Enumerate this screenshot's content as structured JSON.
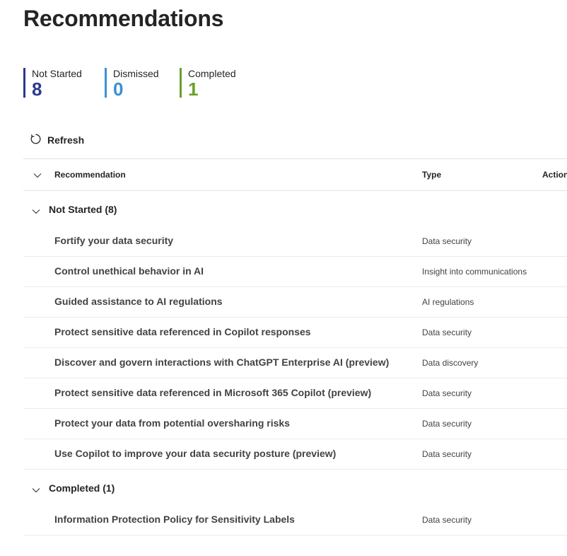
{
  "page": {
    "title": "Recommendations"
  },
  "stats": [
    {
      "label": "Not Started",
      "value": "8",
      "color": "#2b3a8c"
    },
    {
      "label": "Dismissed",
      "value": "0",
      "color": "#3b8fd6"
    },
    {
      "label": "Completed",
      "value": "1",
      "color": "#6a9f2c"
    }
  ],
  "toolbar": {
    "refresh_label": "Refresh",
    "refresh_icon": "refresh-icon"
  },
  "table": {
    "columns": {
      "recommendation": "Recommendation",
      "type": "Type",
      "actions": "Action"
    },
    "groups": [
      {
        "label": "Not Started (8)",
        "rows": [
          {
            "name": "Fortify your data security",
            "type": "Data security"
          },
          {
            "name": "Control unethical behavior in AI",
            "type": "Insight into communications"
          },
          {
            "name": "Guided assistance to AI regulations",
            "type": "AI regulations"
          },
          {
            "name": "Protect sensitive data referenced in Copilot responses",
            "type": "Data security"
          },
          {
            "name": "Discover and govern interactions with ChatGPT Enterprise AI (preview)",
            "type": "Data discovery"
          },
          {
            "name": "Protect sensitive data referenced in Microsoft 365 Copilot (preview)",
            "type": "Data security"
          },
          {
            "name": "Protect your data from potential oversharing risks",
            "type": "Data security"
          },
          {
            "name": "Use Copilot to improve your data security posture (preview)",
            "type": "Data security"
          }
        ]
      },
      {
        "label": "Completed (1)",
        "rows": [
          {
            "name": "Information Protection Policy for Sensitivity Labels",
            "type": "Data security"
          }
        ]
      }
    ]
  }
}
